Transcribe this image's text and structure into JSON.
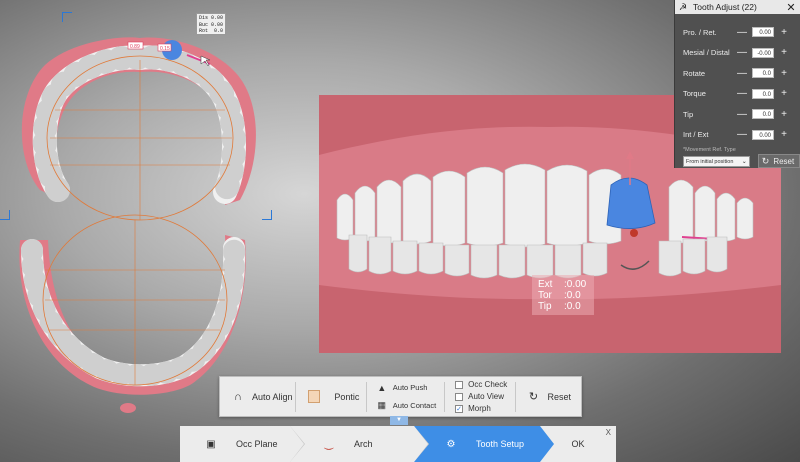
{
  "occlusal_view": {
    "info": [
      {
        "key": "Dis",
        "value": "0.00"
      },
      {
        "key": "Buc",
        "value": "0.00"
      },
      {
        "key": "Rot",
        "value": "0.0"
      }
    ],
    "tooth_tags": [
      "0.89",
      "0.15"
    ]
  },
  "frontal_view": {
    "readout": [
      {
        "key": "Ext",
        "value": "0.00"
      },
      {
        "key": "Tor",
        "value": "0.0"
      },
      {
        "key": "Tip",
        "value": "0.0"
      }
    ]
  },
  "tooth_adjust": {
    "title": "Tooth Adjust",
    "tooth_number": "(22)",
    "rows": [
      {
        "label": "Pro. / Ret.",
        "value": "0.00"
      },
      {
        "label": "Mesial / Distal",
        "value": "-0.00"
      },
      {
        "label": "Rotate",
        "value": "0.0"
      },
      {
        "label": "Torque",
        "value": "0.0"
      },
      {
        "label": "Tip",
        "value": "0.0"
      },
      {
        "label": "Int / Ext",
        "value": "0.00"
      }
    ],
    "movement_ref_label": "*Movement Ref. Type",
    "movement_ref_value": "From initial position",
    "reset_label": "Reset"
  },
  "tool_panel": {
    "auto_align": "Auto Align",
    "pontic": "Pontic",
    "auto_push": "Auto Push",
    "auto_contact": "Auto Contact",
    "occ_check": "Occ Check",
    "auto_view": "Auto View",
    "morph": "Morph",
    "reset": "Reset",
    "checks": {
      "occ_check": false,
      "auto_view": false,
      "morph": true
    }
  },
  "workflow": {
    "steps": [
      "Occ Plane",
      "Arch",
      "Tooth Setup",
      "OK"
    ],
    "active": "Tooth Setup",
    "close": "X"
  },
  "colors": {
    "gum": "#d97b87",
    "selected_tooth": "#4a86e0",
    "active_step": "#3e8ee6",
    "arch_line": "#e07a3a"
  }
}
